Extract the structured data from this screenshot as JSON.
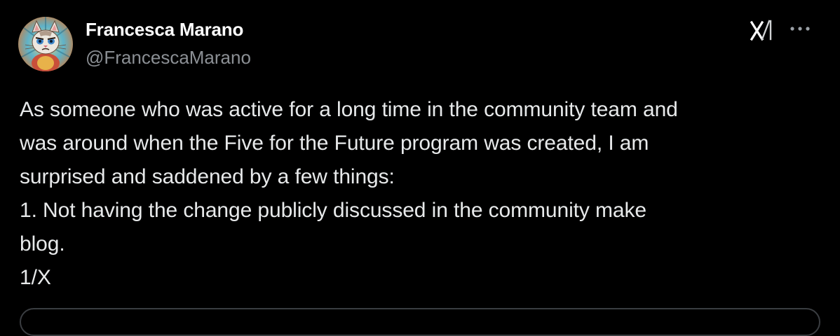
{
  "author": {
    "display_name": "Francesca Marano",
    "handle": "@FrancescaMarano",
    "avatar_icon": "cat-avatar-icon"
  },
  "header_actions": {
    "logo_icon": "x-logo-icon",
    "more_icon": "more-options-icon"
  },
  "post": {
    "text": "As someone who was active for a long time in the community team and\nwas around when the Five for the Future program was created, I am\nsurprised and saddened by a few things:\n1. Not having the change publicly discussed in the community make\nblog.\n1/X"
  },
  "colors": {
    "background": "#000000",
    "text_primary": "#e7e9ea",
    "text_secondary": "#8b8f94",
    "border": "#3a3d41"
  }
}
